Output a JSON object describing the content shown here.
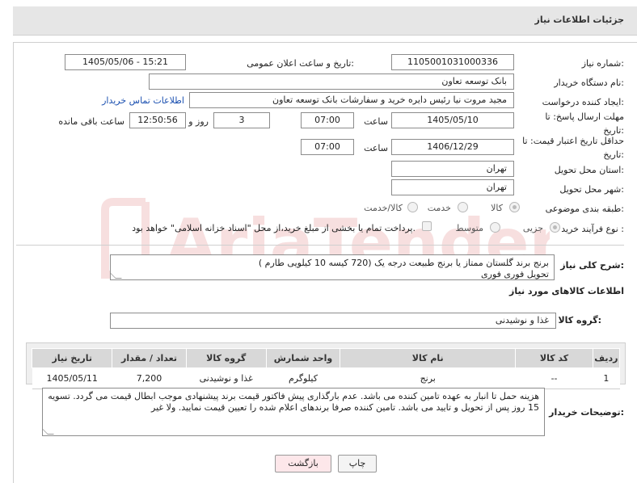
{
  "header": {
    "title": "جزئیات اطلاعات نیاز"
  },
  "fields": {
    "need_number_label": "شماره نیاز:",
    "need_number": "1105001031000336",
    "announce_label": "تاریخ و ساعت اعلان عمومی:",
    "announce_value": "1405/05/06 - 15:21",
    "buyer_org_label": "نام دستگاه خریدار:",
    "buyer_org": "بانک توسعه تعاون",
    "creator_label": "ایجاد کننده درخواست:",
    "creator": "مجید مروت نیا رئیس دایره خرید و سفارشات بانک توسعه تعاون",
    "contact_link": "اطلاعات تماس خریدار",
    "reply_deadline_label": "مهلت ارسال پاسخ: تا تاریخ:",
    "reply_date": "1405/05/10",
    "time_label": "ساعت",
    "reply_time": "07:00",
    "days": "3",
    "days_label": "روز و",
    "remaining": "12:50:56",
    "remaining_label": "ساعت باقی مانده",
    "price_validity_label": "حداقل تاریخ اعتبار قیمت: تا تاریخ:",
    "validity_date": "1406/12/29",
    "validity_time": "07:00",
    "province_label": "استان محل تحویل:",
    "province": "تهران",
    "city_label": "شهر محل تحویل:",
    "city": "تهران",
    "category_label": "طبقه بندی موضوعی:",
    "cat_goods": "کالا",
    "cat_service": "خدمت",
    "cat_both": "کالا/خدمت",
    "process_label": "نوع فرآیند خرید :",
    "proc_partial": "جزیی",
    "proc_medium": "متوسط",
    "payment_note": "پرداخت تمام یا بخشی از مبلغ خرید،از محل \"اسناد خزانه اسلامی\" خواهد بود."
  },
  "description": {
    "label": "شرح کلی نیاز:",
    "line1": "برنج برند گلستان ممتاز یا برنج طبیعت درجه یک (720 کیسه 10 کیلویی طارم )",
    "line2": "تحویل فوری فوری"
  },
  "goods": {
    "section_title": "اطلاعات کالاهای مورد نیاز",
    "group_label": "گروه کالا:",
    "group_value": "غذا و نوشیدنی",
    "columns": [
      "ردیف",
      "کد کالا",
      "نام کالا",
      "واحد شمارش",
      "گروه کالا",
      "تعداد / مقدار",
      "تاریخ نیاز"
    ],
    "rows": [
      [
        "1",
        "--",
        "برنج",
        "کیلوگرم",
        "غذا و نوشیدنی",
        "7,200",
        "1405/05/11"
      ]
    ]
  },
  "buyer_notes": {
    "label": "توضیحات خریدار:",
    "text": "هزینه حمل تا انبار به عهده تامین کننده می باشد. عدم بارگذاری پیش فاکتور قیمت برند پیشنهادی موجب ابطال قیمت می گردد. تسویه 15 روز پس از تحویل و تایید می باشد. تامین کننده صرفا برندهای اعلام شده را تعیین قیمت نمایید. ولا غیر"
  },
  "buttons": {
    "print": "چاپ",
    "back": "بازگشت"
  },
  "watermark": "AriaTender.net"
}
